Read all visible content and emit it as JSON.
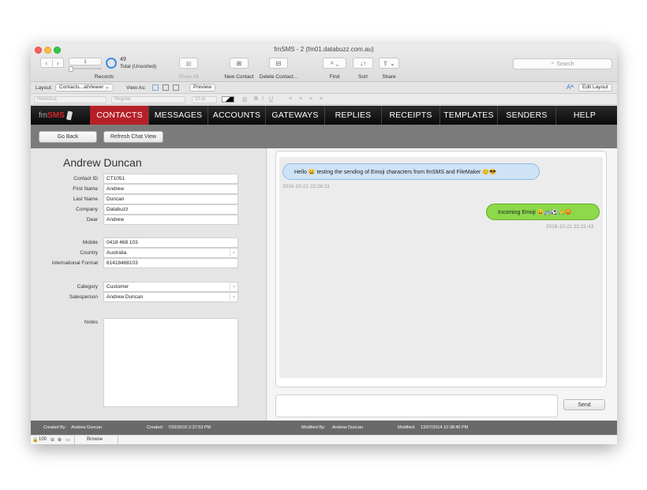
{
  "window": {
    "title": "fmSMS - 2 (fm01.databuzz.com.au)"
  },
  "toolbar": {
    "record_field": "1",
    "records_label": "Records",
    "total_count": "49",
    "total_label": "Total (Unsorted)",
    "show_all": "Show All",
    "new_contact": "New Contact",
    "delete_contact": "Delete Contact...",
    "find": "Find",
    "sort": "Sort",
    "share": "Share",
    "search_placeholder": "Search"
  },
  "layout_bar": {
    "layout_label": "Layout:",
    "layout_value": "Contacts...atViewer",
    "view_as_label": "View As:",
    "preview": "Preview",
    "edit_layout": "Edit Layout"
  },
  "format_bar": {
    "font": "Helvetica",
    "style": "Regular",
    "size": "10 pt"
  },
  "nav": {
    "logo_prefix": "fm",
    "logo_brand": "SMS",
    "items": [
      {
        "label": "CONTACTS",
        "active": true
      },
      {
        "label": "MESSAGES"
      },
      {
        "label": "ACCOUNTS"
      },
      {
        "label": "GATEWAYS"
      },
      {
        "label": "REPLIES"
      },
      {
        "label": "RECEIPTS"
      },
      {
        "label": "TEMPLATES"
      },
      {
        "label": "SENDERS"
      },
      {
        "label": "HELP"
      }
    ]
  },
  "actions": {
    "go_back": "Go Back",
    "refresh": "Refresh Chat View"
  },
  "contact": {
    "name": "Andrew Duncan",
    "fields": {
      "contact_id": {
        "label": "Contact ID",
        "value": "CT1051"
      },
      "first_name": {
        "label": "First Name",
        "value": "Andrew"
      },
      "last_name": {
        "label": "Last Name",
        "value": "Duncan"
      },
      "company": {
        "label": "Company",
        "value": "Databuzz"
      },
      "dear": {
        "label": "Dear",
        "value": "Andrew"
      },
      "mobile": {
        "label": "Mobile",
        "value": "0418 468 103"
      },
      "country": {
        "label": "Country",
        "value": "Australia"
      },
      "intl_format": {
        "label": "International Format",
        "value": "61418468103"
      },
      "category": {
        "label": "Category",
        "value": "Customer"
      },
      "salesperson": {
        "label": "Salesperson",
        "value": "Andrew Duncan"
      },
      "notes": {
        "label": "Notes",
        "value": ""
      }
    }
  },
  "chat": {
    "incoming": {
      "text": "Hello 😀 testing the sending of Emoji characters from fmSMS and FileMaker 😊😎",
      "timestamp": "2016-10-21 22:26:11"
    },
    "outgoing": {
      "text": "Incoming Emoji 😀🚌⚽🙏😡",
      "timestamp": "2016-10-21 22:31:43"
    },
    "send_label": "Send"
  },
  "footer": {
    "created_by_label": "Created By:",
    "created_by": "Andrew Duncan",
    "created_label": "Created:",
    "created": "7/02/2010 2:37:53 PM",
    "modified_by_label": "Modified By:",
    "modified_by": "Andrew Duncan",
    "modified_label": "Modified:",
    "modified": "13/07/2014 10:38:40 PM"
  },
  "status": {
    "zoom": "100",
    "mode": "Browse"
  },
  "colors": {
    "nav_active": "#b52028",
    "incoming_bubble": "#cfe3f7",
    "outgoing_bubble": "#8cd94a"
  }
}
